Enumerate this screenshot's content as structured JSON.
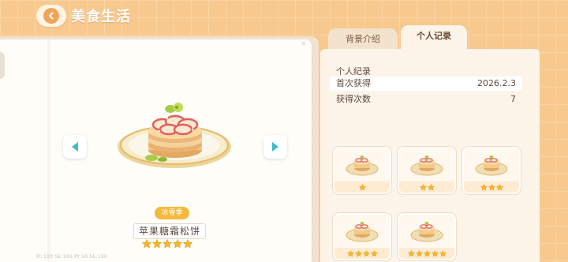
{
  "header": {
    "title": "美食生活",
    "back_icon": "chevron-left-icon"
  },
  "dish": {
    "season_tag": "冰雪季",
    "name": "苹果糖霜松饼",
    "stars": 5,
    "footer_text": "Pt:100  Sk:100  Pt:50  Sk:100"
  },
  "tabs": [
    {
      "label": "背景介绍",
      "active": false
    },
    {
      "label": "个人记录",
      "active": true
    }
  ],
  "record": {
    "title": "个人纪录",
    "rows": [
      {
        "label": "首次获得",
        "value": "2026.2.3"
      },
      {
        "label": "获得次数",
        "value": "7"
      }
    ]
  },
  "variants": [
    {
      "stars": 1
    },
    {
      "stars": 2
    },
    {
      "stars": 3
    },
    {
      "stars": 4
    },
    {
      "stars": 5
    }
  ],
  "colors": {
    "background": "#f8c98f",
    "star": "#f6b82a",
    "accent": "#f0a457",
    "teal_arrow": "#3cbcc4"
  }
}
